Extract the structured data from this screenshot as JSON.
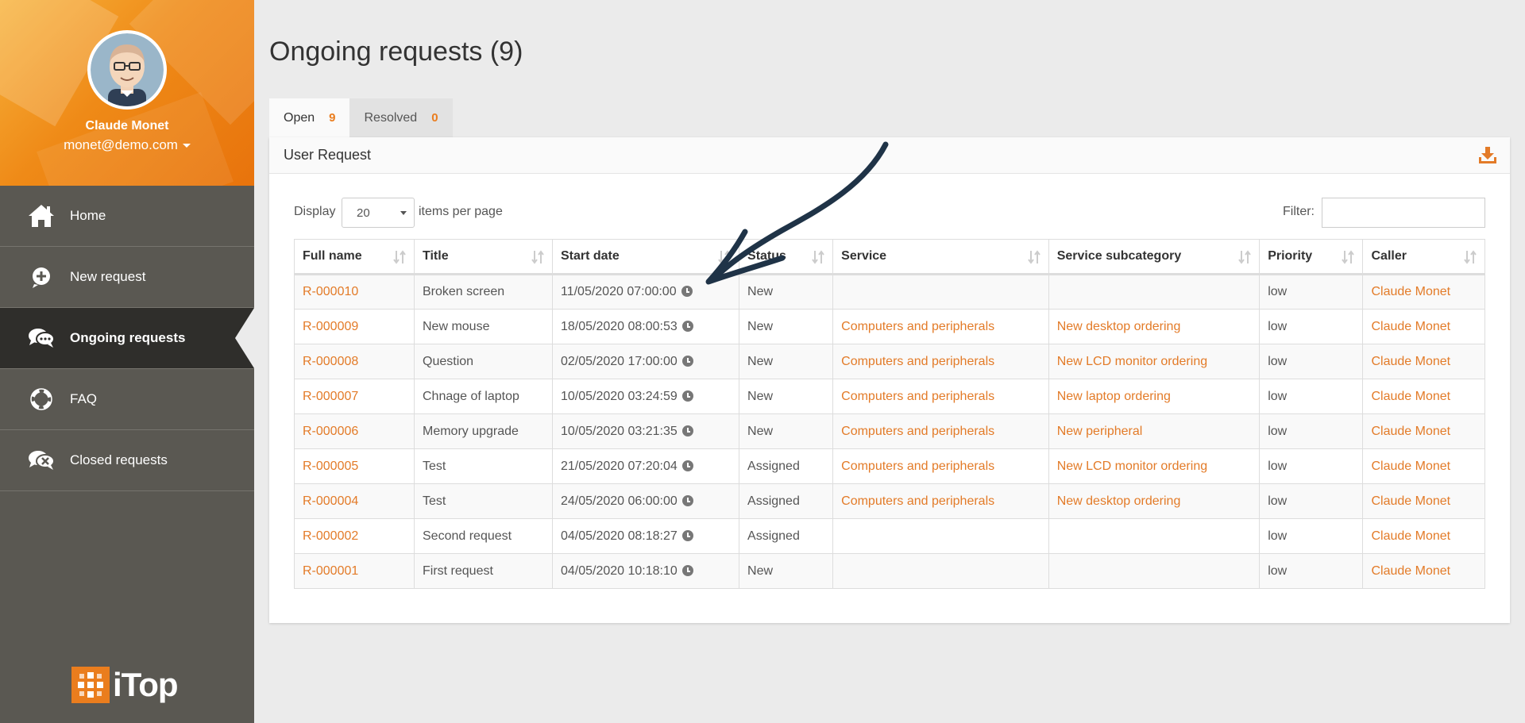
{
  "user": {
    "name": "Claude Monet",
    "email": "monet@demo.com"
  },
  "nav": [
    {
      "label": "Home",
      "icon": "home-icon"
    },
    {
      "label": "New request",
      "icon": "plus-circle-icon"
    },
    {
      "label": "Ongoing requests",
      "icon": "comments-icon",
      "active": true
    },
    {
      "label": "FAQ",
      "icon": "lifebuoy-icon"
    },
    {
      "label": "Closed requests",
      "icon": "closed-comments-icon"
    }
  ],
  "logo_text": "iTop",
  "page_title": "Ongoing requests (9)",
  "tabs": [
    {
      "label": "Open",
      "count": "9",
      "active": true
    },
    {
      "label": "Resolved",
      "count": "0"
    }
  ],
  "panel": {
    "title": "User Request",
    "display_label": "Display",
    "page_size": "20",
    "per_page_label": "items per page",
    "filter_label": "Filter:",
    "filter_value": ""
  },
  "table": {
    "columns": [
      "Full name",
      "Title",
      "Start date",
      "Status",
      "Service",
      "Service subcategory",
      "Priority",
      "Caller"
    ],
    "rows": [
      {
        "ref": "R-000010",
        "title": "Broken screen",
        "start": "11/05/2020 07:00:00",
        "status": "New",
        "service": "",
        "subcategory": "",
        "priority": "low",
        "caller": "Claude Monet"
      },
      {
        "ref": "R-000009",
        "title": "New mouse",
        "start": "18/05/2020 08:00:53",
        "status": "New",
        "service": "Computers and peripherals",
        "subcategory": "New desktop ordering",
        "priority": "low",
        "caller": "Claude Monet"
      },
      {
        "ref": "R-000008",
        "title": "Question",
        "start": "02/05/2020 17:00:00",
        "status": "New",
        "service": "Computers and peripherals",
        "subcategory": "New LCD monitor ordering",
        "priority": "low",
        "caller": "Claude Monet"
      },
      {
        "ref": "R-000007",
        "title": "Chnage of laptop",
        "start": "10/05/2020 03:24:59",
        "status": "New",
        "service": "Computers and peripherals",
        "subcategory": "New laptop ordering",
        "priority": "low",
        "caller": "Claude Monet"
      },
      {
        "ref": "R-000006",
        "title": "Memory upgrade",
        "start": "10/05/2020 03:21:35",
        "status": "New",
        "service": "Computers and peripherals",
        "subcategory": "New peripheral",
        "priority": "low",
        "caller": "Claude Monet"
      },
      {
        "ref": "R-000005",
        "title": "Test",
        "start": "21/05/2020 07:20:04",
        "status": "Assigned",
        "service": "Computers and peripherals",
        "subcategory": "New LCD monitor ordering",
        "priority": "low",
        "caller": "Claude Monet"
      },
      {
        "ref": "R-000004",
        "title": "Test",
        "start": "24/05/2020 06:00:00",
        "status": "Assigned",
        "service": "Computers and peripherals",
        "subcategory": "New desktop ordering",
        "priority": "low",
        "caller": "Claude Monet"
      },
      {
        "ref": "R-000002",
        "title": "Second request",
        "start": "04/05/2020 08:18:27",
        "status": "Assigned",
        "service": "",
        "subcategory": "",
        "priority": "low",
        "caller": "Claude Monet"
      },
      {
        "ref": "R-000001",
        "title": "First request",
        "start": "04/05/2020 10:18:10",
        "status": "New",
        "service": "",
        "subcategory": "",
        "priority": "low",
        "caller": "Claude Monet"
      }
    ]
  },
  "colors": {
    "accent": "#ea7d1e",
    "link": "#e37b28",
    "sidebar": "#5a5852",
    "sidebar_active": "#2f2e2b",
    "annotation_arrow": "#1f3347"
  }
}
